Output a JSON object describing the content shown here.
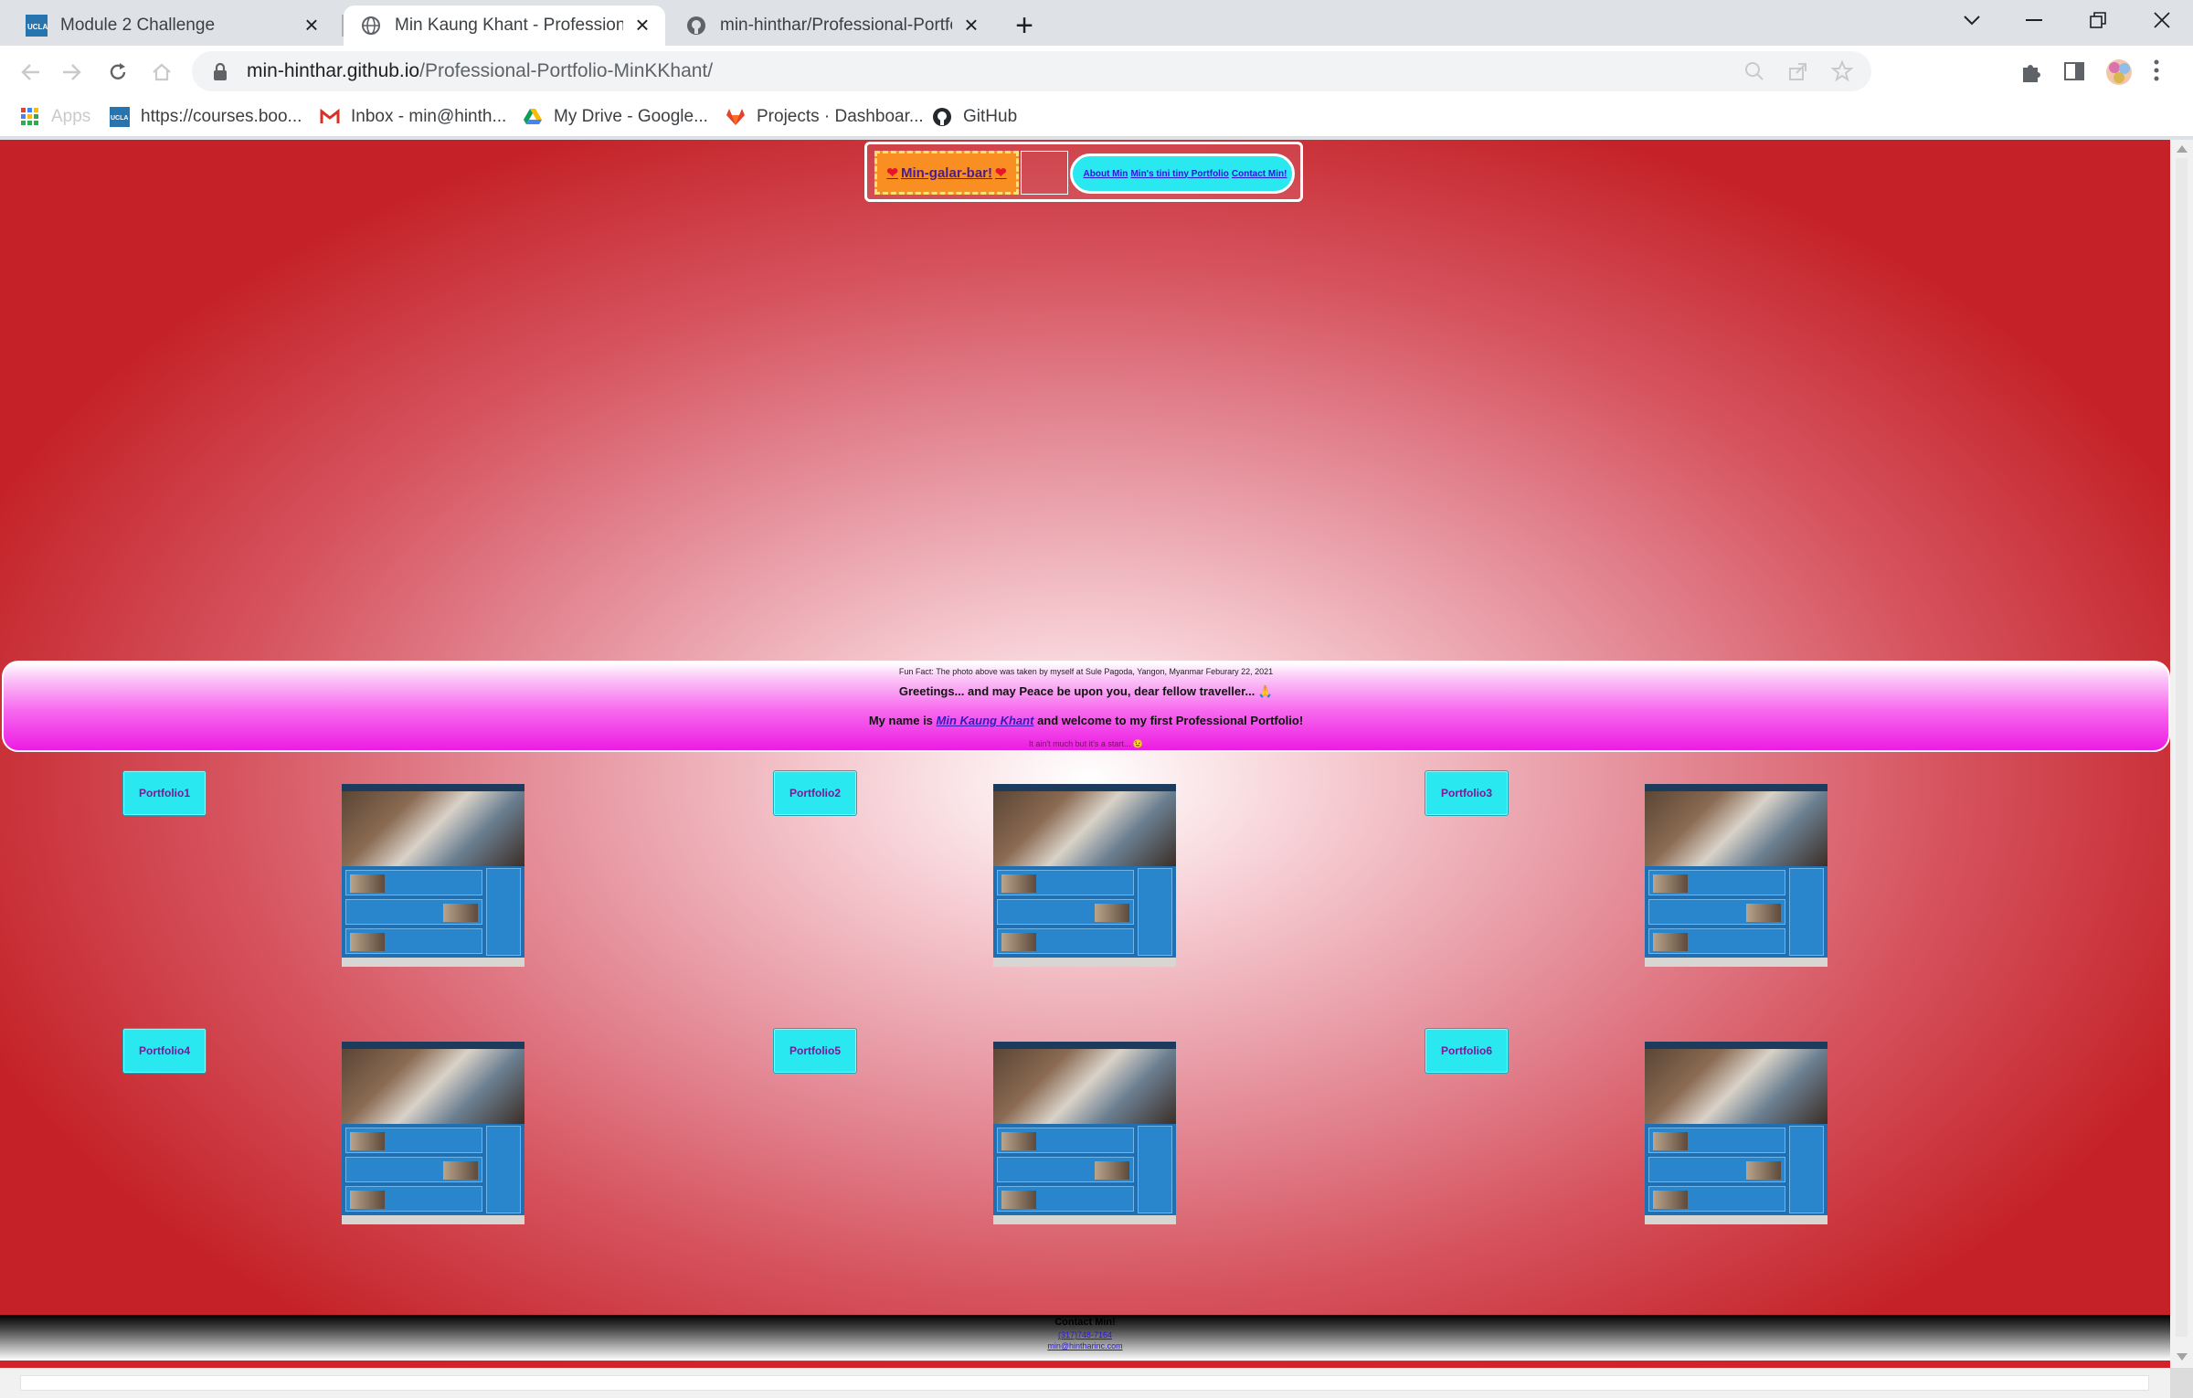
{
  "browser": {
    "tabs": [
      {
        "title": "Module 2 Challenge",
        "favicon": "ucla-icon",
        "active": false
      },
      {
        "title": "Min Kaung Khant - Professional P",
        "favicon": "globe-icon",
        "active": true
      },
      {
        "title": "min-hinthar/Professional-Portfoli",
        "favicon": "github-icon",
        "active": false
      }
    ],
    "address": {
      "host": "min-hinthar.github.io",
      "path": "/Professional-Portfolio-MinKKhant/"
    },
    "bookmarks": [
      {
        "label": "Apps",
        "icon": "apps-grid-icon"
      },
      {
        "label": "https://courses.boo...",
        "icon": "ucla-icon"
      },
      {
        "label": "Inbox - min@hinth...",
        "icon": "gmail-icon"
      },
      {
        "label": "My Drive - Google...",
        "icon": "drive-icon"
      },
      {
        "label": "Projects · Dashboar...",
        "icon": "gitlab-icon"
      },
      {
        "label": "GitHub",
        "icon": "github-icon"
      }
    ]
  },
  "page": {
    "header": {
      "brand": "Min-galar-bar!",
      "nav": [
        "About Min",
        "Min's tini tiny Portfolio",
        "Contact Min!"
      ]
    },
    "banner": {
      "fun_fact": "Fun Fact: The photo above was taken by myself at Sule Pagoda, Yangon, Myanmar Feburary 22, 2021",
      "greeting": "Greetings... and may Peace be upon you, dear fellow traveller... 🙏",
      "intro_prefix": "My name is",
      "intro_name": "Min Kaung Khant",
      "intro_suffix": "and welcome to my first Professional Portfolio!",
      "tagline": "It ain't much but it's a start... 😉"
    },
    "portfolio": [
      {
        "label": "Portfolio1"
      },
      {
        "label": "Portfolio2"
      },
      {
        "label": "Portfolio3"
      },
      {
        "label": "Portfolio4"
      },
      {
        "label": "Portfolio5"
      },
      {
        "label": "Portfolio6"
      }
    ],
    "footer": {
      "title": "Contact Min!",
      "phone": "(317)748-7164",
      "email": "min@hintharinc.com"
    }
  }
}
